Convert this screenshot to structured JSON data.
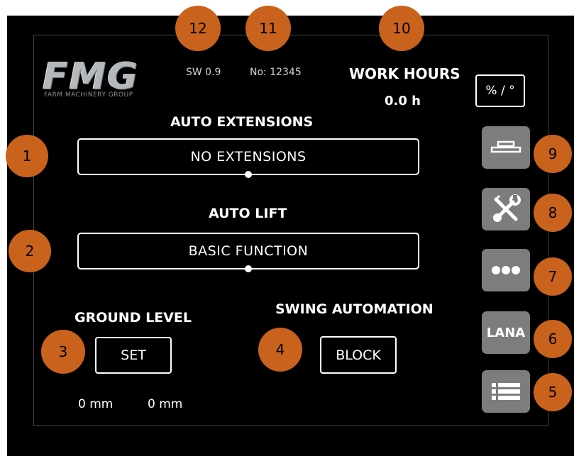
{
  "logo": {
    "text": "FMG",
    "subtitle": "FARM MACHINERY GROUP"
  },
  "header": {
    "software_version": "SW 0.9",
    "serial_number": "No: 12345",
    "work_hours_label": "WORK HOURS",
    "work_hours_value": "0.0 h",
    "unit_toggle_label": "% / °"
  },
  "auto_extensions": {
    "label": "AUTO EXTENSIONS",
    "value": "NO EXTENSIONS"
  },
  "auto_lift": {
    "label": "AUTO LIFT",
    "value": "BASIC FUNCTION"
  },
  "ground_level": {
    "label": "GROUND LEVEL",
    "set_label": "SET",
    "value_left": "0 mm",
    "value_right": "0 mm"
  },
  "swing_automation": {
    "label": "SWING AUTOMATION",
    "block_label": "BLOCK"
  },
  "side_buttons": {
    "implement_icon": "implement-icon",
    "tools_icon": "wrench-screwdriver-icon",
    "more_icon": "more-dots-icon",
    "lana_label": "LANA",
    "list_icon": "list-icon"
  },
  "callouts": [
    "1",
    "2",
    "3",
    "4",
    "5",
    "6",
    "7",
    "8",
    "9",
    "10",
    "11",
    "12"
  ],
  "colors": {
    "callout": "#c9621c",
    "screen": "#000000",
    "side_button": "#7d7d7d"
  }
}
